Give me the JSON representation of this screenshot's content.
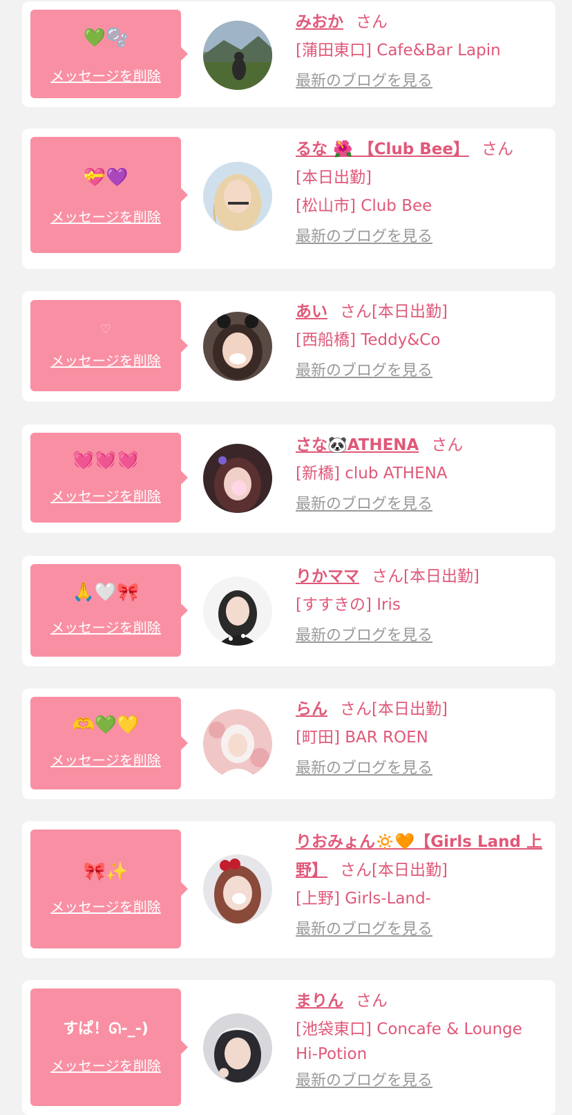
{
  "delete_label": "メッセージを削除",
  "blog_label": "最新のブログを見る",
  "san_label": "さん",
  "colors": {
    "accent": "#e05878",
    "bubble": "#f98fa3",
    "background": "#f2f2f2",
    "blog_link": "#999999"
  },
  "messages": [
    {
      "bubble_text": "💚🫧",
      "name": "みおか",
      "after_san": "",
      "lines": [
        "[蒲田東口] Cafe&Bar Lapin"
      ]
    },
    {
      "bubble_text": "💝💜",
      "name": "るな 🌺 【Club Bee】",
      "after_san": "",
      "lines": [
        "[本日出勤]",
        "[松山市] Club Bee"
      ]
    },
    {
      "bubble_text": "♡",
      "name": "あい",
      "after_san": "[本日出勤]",
      "lines": [
        "[西船橋] Teddy&Co"
      ]
    },
    {
      "bubble_text": "💓💓💓",
      "name": "さな🐼ATHENA",
      "after_san": "",
      "lines": [
        "[新橋] club ATHENA"
      ]
    },
    {
      "bubble_text": "🙏🤍🎀",
      "name": "りかママ",
      "after_san": "[本日出勤]",
      "lines": [
        "[すすきの] Iris"
      ]
    },
    {
      "bubble_text": "🫶💚💛",
      "name": "らん",
      "after_san": "[本日出勤]",
      "lines": [
        "[町田] BAR ROEN"
      ]
    },
    {
      "bubble_text": "🎀✨",
      "name": "りおみょん🔅🧡【Girls Land 上野】",
      "after_san": "[本日出勤]",
      "lines": [
        "[上野] Girls-Land-"
      ]
    },
    {
      "bubble_text": "すぱ！ᘏ-_-)",
      "name": "まりん",
      "after_san": "",
      "lines": [
        "[池袋東口] Concafe & Lounge",
        "Hi-Potion"
      ]
    }
  ]
}
